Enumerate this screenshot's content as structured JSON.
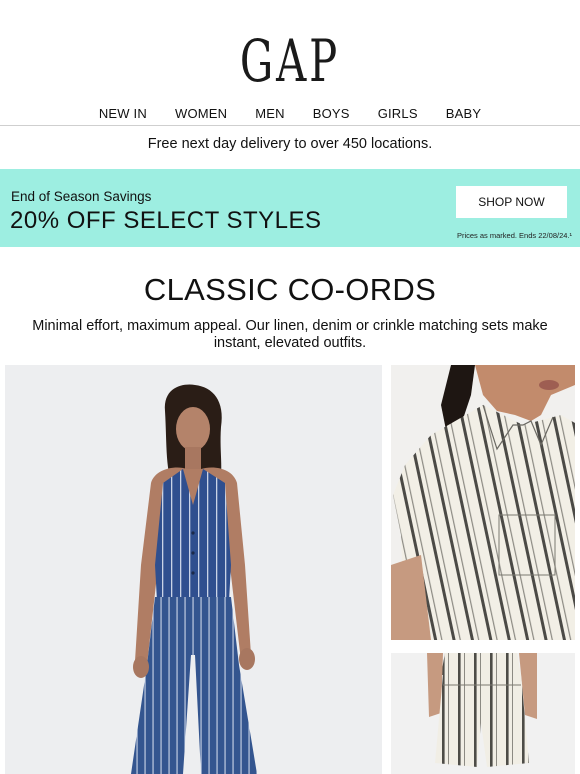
{
  "brand": {
    "logo": "GAP"
  },
  "nav": {
    "items": [
      "NEW IN",
      "WOMEN",
      "MEN",
      "BOYS",
      "GIRLS",
      "BABY"
    ]
  },
  "delivery": {
    "text": "Free next day delivery to over 450 locations."
  },
  "promo": {
    "subtitle": "End of Season Savings",
    "title": "20% OFF SELECT STYLES",
    "button_label": "SHOP NOW",
    "note": "Prices as marked. Ends 22/08/24.¹",
    "background_color": "#9deee1"
  },
  "section": {
    "title": "CLASSIC CO-ORDS",
    "description": "Minimal effort, maximum appeal. Our linen, denim or crinkle matching sets make instant, elevated outfits."
  },
  "images": {
    "main": "model-denim-striped-vest-and-wide-leg-jeans",
    "top": "striped-linen-shirt-closeup",
    "bottom": "striped-linen-shorts-closeup"
  }
}
